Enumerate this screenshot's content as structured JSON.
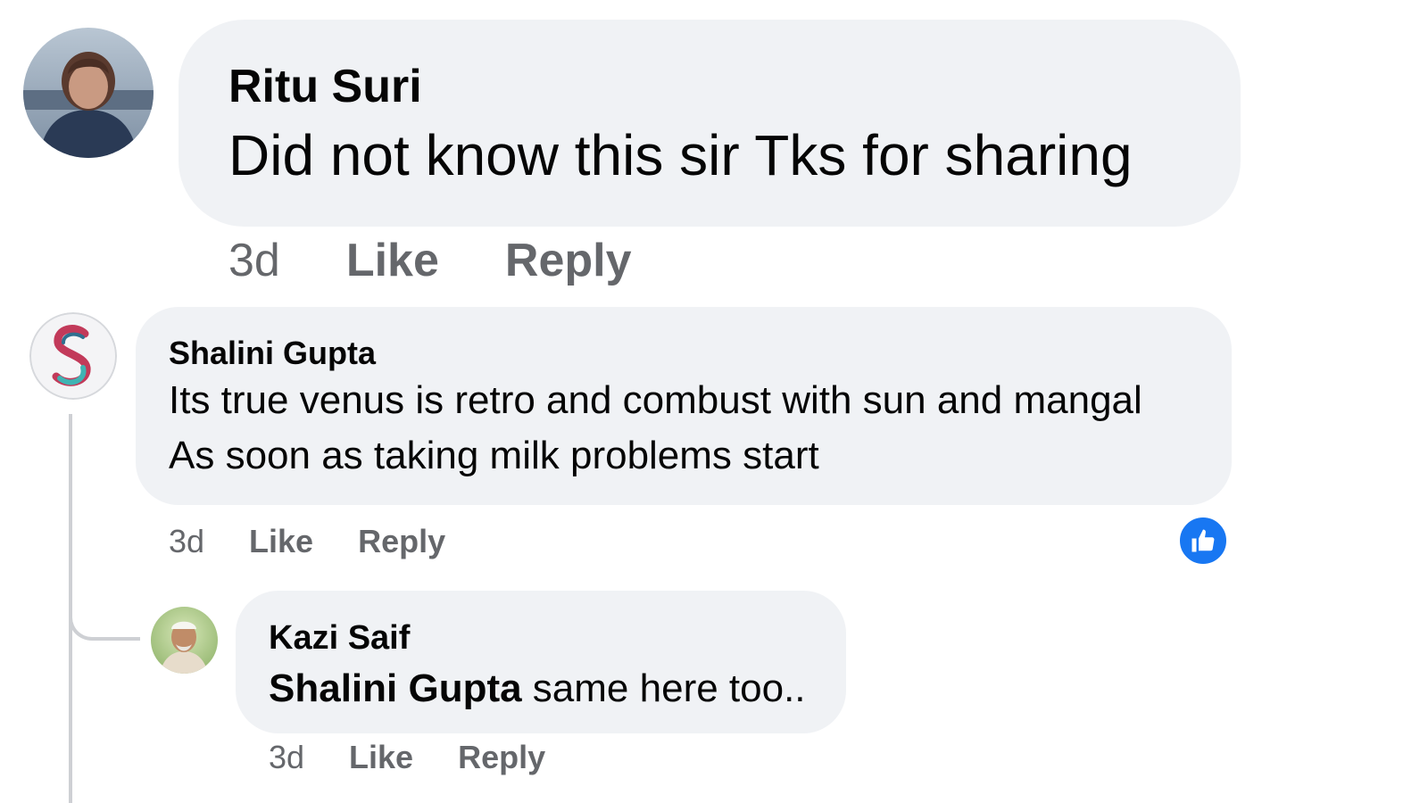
{
  "comments": [
    {
      "author": "Ritu Suri",
      "text": "Did not know this sir Tks for sharing",
      "time": "3d",
      "like_label": "Like",
      "reply_label": "Reply",
      "avatar_icon": "avatar-photo-woman"
    },
    {
      "author": "Shalini Gupta",
      "text_lines": [
        "Its true venus is retro and combust with sun and mangal",
        "As soon as taking milk problems start"
      ],
      "time": "3d",
      "like_label": "Like",
      "reply_label": "Reply",
      "avatar_icon": "avatar-monogram-s",
      "reaction_icon": "like-reaction-icon",
      "reaction_color": "#1877f2",
      "replies": [
        {
          "author": "Kazi Saif",
          "mention": "Shalini Gupta",
          "text": " same here too..",
          "time": "3d",
          "like_label": "Like",
          "reply_label": "Reply",
          "avatar_icon": "avatar-photo-man"
        }
      ]
    }
  ],
  "colors": {
    "bubble": "#f0f2f5",
    "meta_text": "#65676b",
    "thread_line": "#ced0d4"
  }
}
